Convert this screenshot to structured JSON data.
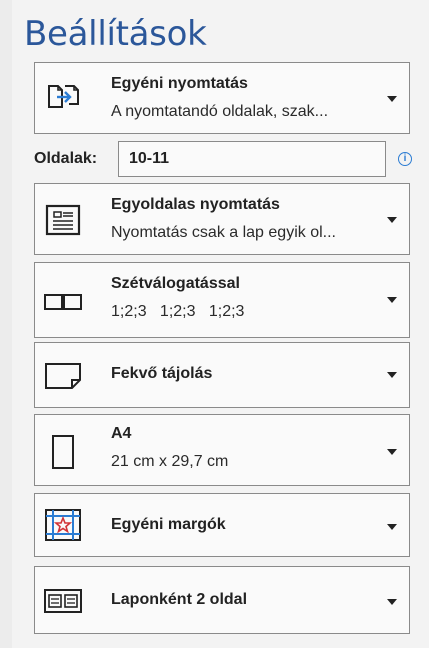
{
  "panel": {
    "title": "Beállítások"
  },
  "print_mode": {
    "label": "Egyéni nyomtatás",
    "description": "A nyomtatandó oldalak, szak...",
    "icon": "custom-print-icon"
  },
  "pages": {
    "label": "Oldalak:",
    "value": "10-11",
    "info_icon": "info-icon",
    "info_glyph": "i"
  },
  "sides": {
    "label": "Egyoldalas nyomtatás",
    "description": "Nyomtatás csak a lap egyik ol...",
    "icon": "one-sided-print-icon"
  },
  "collation": {
    "label": "Szétválogatással",
    "description": "1;2;3   1;2;3   1;2;3",
    "icon": "collated-icon"
  },
  "orientation": {
    "label": "Fekvő tájolás",
    "icon": "landscape-orientation-icon"
  },
  "paper_size": {
    "label": "A4",
    "description": "21 cm x 29,7 cm",
    "icon": "paper-size-icon"
  },
  "margins": {
    "label": "Egyéni margók",
    "icon": "custom-margins-icon",
    "accent": "#2b7cd3",
    "star_color": "#d13438"
  },
  "pages_per_sheet": {
    "label": "Laponként 2 oldal",
    "icon": "pages-per-sheet-icon"
  },
  "colors": {
    "title": "#2b579a",
    "border": "#8a8a8a",
    "background": "#f3f3f3"
  }
}
